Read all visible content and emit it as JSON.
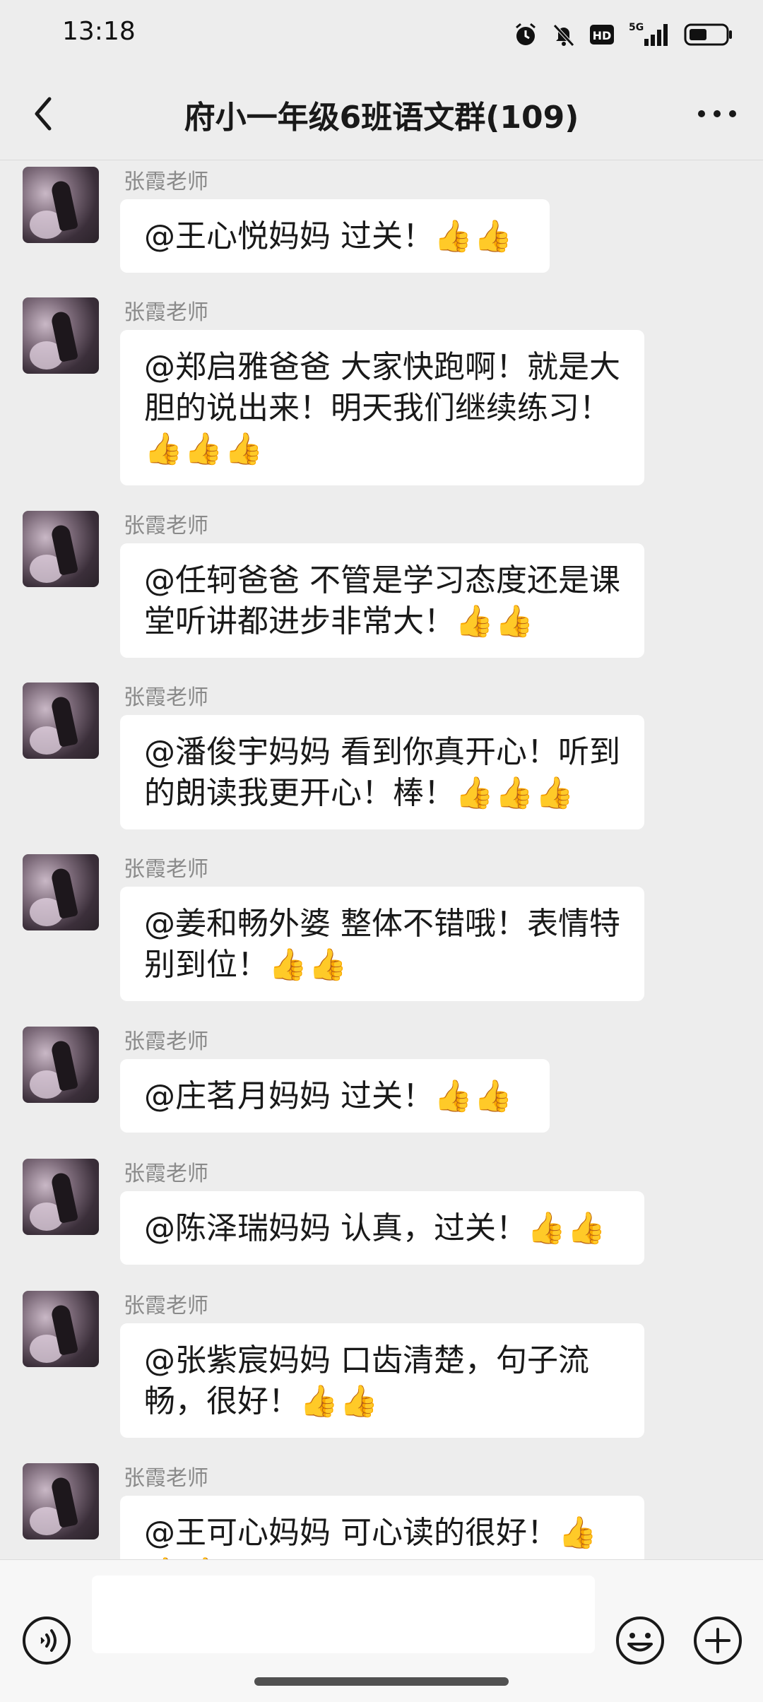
{
  "status_bar": {
    "time": "13:18",
    "network": "5G"
  },
  "header": {
    "title": "府小一年级6班语文群(109)"
  },
  "messages": [
    {
      "sender": "张霞老师",
      "text": "@王心悦妈妈  过关！",
      "thumbs": "👍👍"
    },
    {
      "sender": "张霞老师",
      "text": "@郑启雅爸爸  大家快跑啊！就是大胆的说出来！明天我们继续练习！",
      "thumbs": "👍👍👍"
    },
    {
      "sender": "张霞老师",
      "text": "@任轲爸爸  不管是学习态度还是课堂听讲都进步非常大！",
      "thumbs": "👍👍"
    },
    {
      "sender": "张霞老师",
      "text": "@潘俊宇妈妈  看到你真开心！听到的朗读我更开心！棒！",
      "thumbs": "👍👍👍"
    },
    {
      "sender": "张霞老师",
      "text": "@姜和畅外婆  整体不错哦！表情特别到位！",
      "thumbs": "👍👍"
    },
    {
      "sender": "张霞老师",
      "text": "@庄茗月妈妈  过关！",
      "thumbs": "👍👍"
    },
    {
      "sender": "张霞老师",
      "text": "@陈泽瑞妈妈  认真，过关！",
      "thumbs": "👍👍"
    },
    {
      "sender": "张霞老师",
      "text": "@张紫宸妈妈  口齿清楚，句子流畅，很好！",
      "thumbs": "👍👍"
    },
    {
      "sender": "张霞老师",
      "text": "@王可心妈妈  可心读的很好！",
      "thumbs": "👍👍👍"
    }
  ],
  "icons": {
    "back": "chevron-left-icon",
    "more": "more-dots-icon",
    "voice": "voice-icon",
    "emoji": "emoji-icon",
    "plus": "plus-icon"
  },
  "colors": {
    "background": "#ededed",
    "bubble": "#ffffff",
    "sender": "#8a8a8a"
  }
}
